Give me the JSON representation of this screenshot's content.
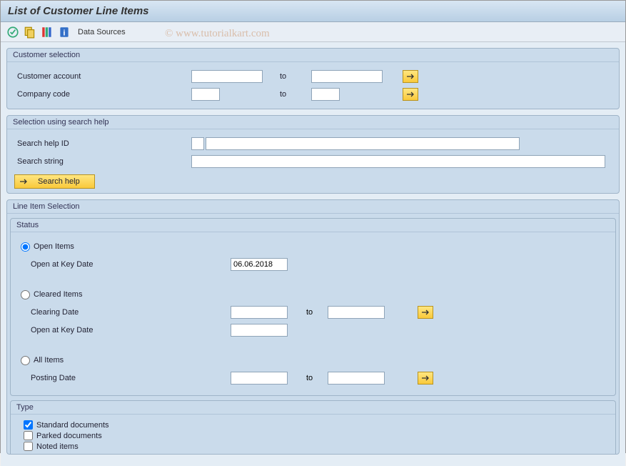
{
  "title": "List of Customer Line Items",
  "watermark": "© www.tutorialkart.com",
  "toolbar": {
    "data_sources_label": "Data Sources"
  },
  "customer_selection": {
    "legend": "Customer selection",
    "account_label": "Customer account",
    "to_label": "to",
    "company_label": "Company code"
  },
  "search_help": {
    "legend": "Selection using search help",
    "id_label": "Search help ID",
    "string_label": "Search string",
    "button_label": "Search help"
  },
  "line_item": {
    "legend": "Line Item Selection",
    "status": {
      "legend": "Status",
      "open_label": "Open Items",
      "open_key_date_label": "Open at Key Date",
      "open_key_date_value": "06.06.2018",
      "cleared_label": "Cleared Items",
      "clearing_date_label": "Clearing Date",
      "to_label": "to",
      "cleared_key_date_label": "Open at Key Date",
      "all_label": "All Items",
      "posting_date_label": "Posting Date"
    },
    "type": {
      "legend": "Type",
      "standard_label": "Standard documents",
      "parked_label": "Parked documents",
      "noted_label": "Noted items",
      "standard_checked": true,
      "parked_checked": false,
      "noted_checked": false
    }
  }
}
